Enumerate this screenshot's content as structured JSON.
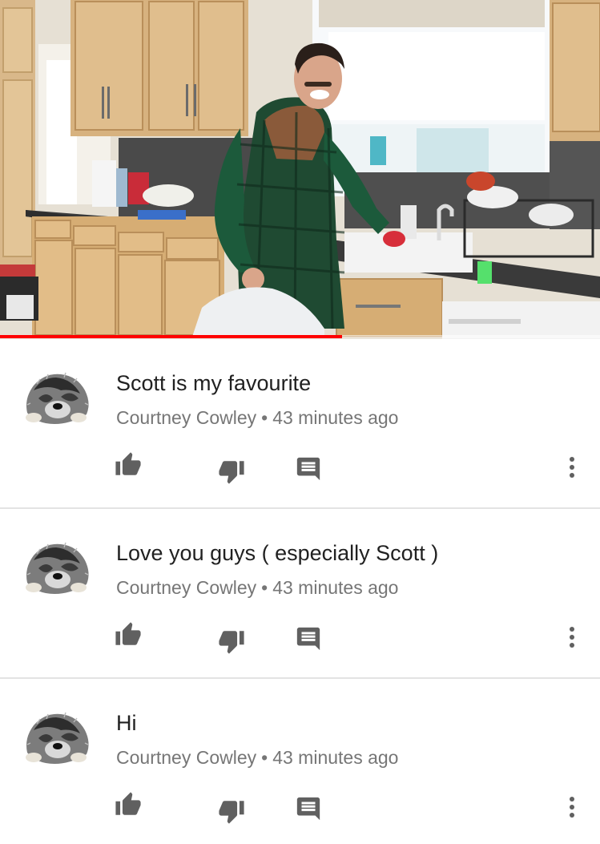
{
  "video": {
    "progress_fraction": 0.57,
    "accent_color": "#ff0000"
  },
  "comments": [
    {
      "text": "Scott is my favourite",
      "author": "Courtney Cowley",
      "separator": "•",
      "time": "43 minutes ago",
      "avatar_icon": "dog-avatar"
    },
    {
      "text": "Love you guys ( especially Scott )",
      "author": "Courtney Cowley",
      "separator": "•",
      "time": "43 minutes ago",
      "avatar_icon": "dog-avatar"
    },
    {
      "text": "Hi",
      "author": "Courtney Cowley",
      "separator": "•",
      "time": "43 minutes ago",
      "avatar_icon": "dog-avatar"
    }
  ],
  "icons": {
    "like": "thumbs-up-icon",
    "dislike": "thumbs-down-icon",
    "reply": "reply-icon",
    "more": "more-vert-icon"
  },
  "colors": {
    "text_primary": "#212121",
    "text_secondary": "#767676",
    "icon": "#606060",
    "divider": "#e3e3e3"
  }
}
